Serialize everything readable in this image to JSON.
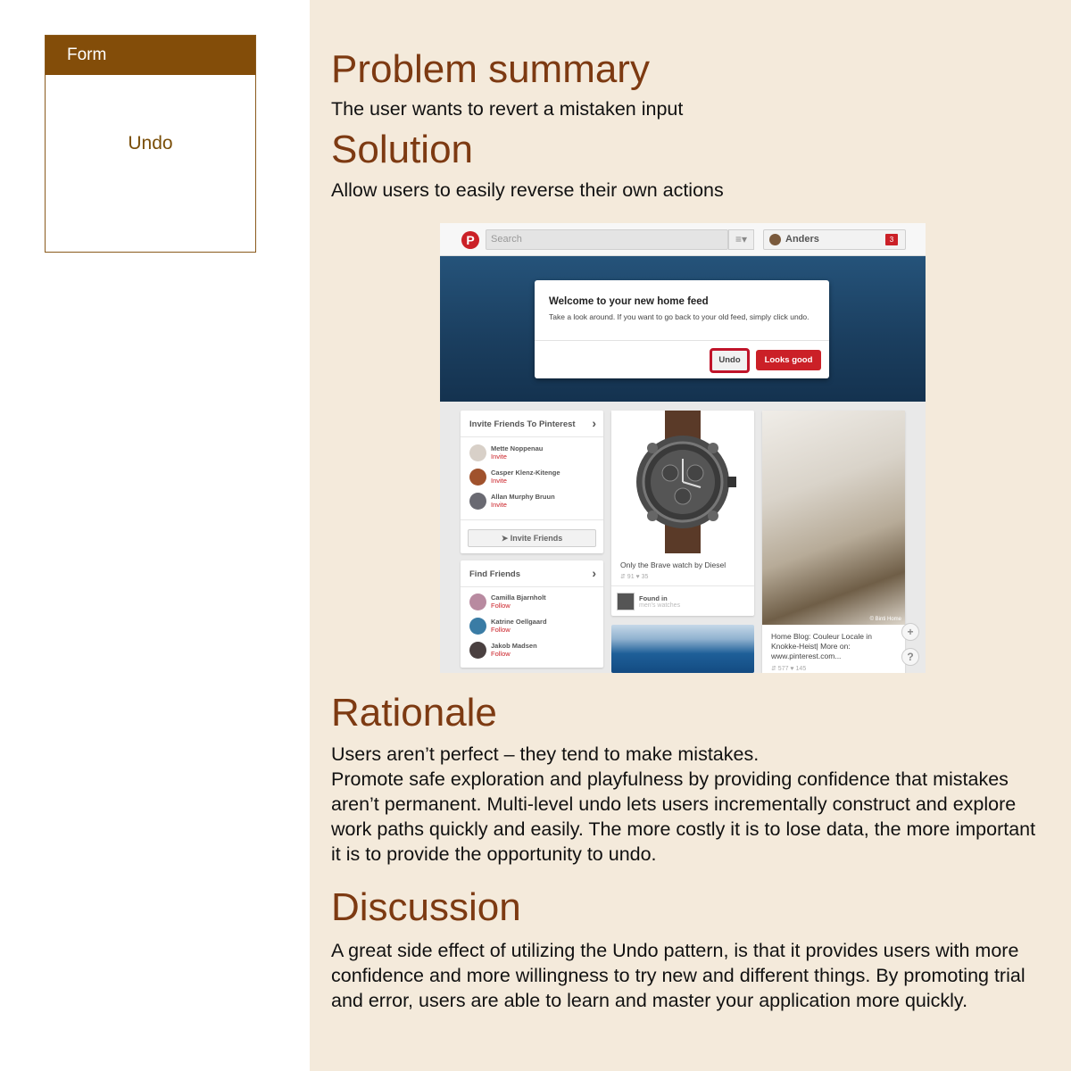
{
  "sidebar": {
    "card_header": "Form",
    "card_item": "Undo"
  },
  "sections": {
    "problem_title": "Problem summary",
    "problem_text": "The user wants to revert a mistaken input",
    "solution_title": "Solution",
    "solution_text": "Allow users to easily reverse their own actions",
    "rationale_title": "Rationale",
    "rationale_line1": "Users aren’t perfect – they tend to make mistakes.",
    "rationale_line2": "Promote safe exploration and playfulness by providing confidence that mistakes aren’t permanent. Multi-level undo lets users incrementally construct and explore work paths quickly and easily. The more costly it is to lose data, the more important it is to provide the opportunity to undo.",
    "discussion_title": "Discussion",
    "discussion_text": "A great side effect of utilizing the Undo pattern, is that it provides users with more confidence and more willingness to try new and different things. By promoting trial and error, users are able to learn and master your application more quickly."
  },
  "screenshot": {
    "logo": "P",
    "search_placeholder": "Search",
    "menu_icon": "≡▾",
    "user_name": "Anders",
    "notification_count": "3",
    "modal_title": "Welcome to your new home feed",
    "modal_text": "Take a look around. If you want to go back to your old feed, simply click undo.",
    "undo_label": "Undo",
    "looks_good_label": "Looks good",
    "invite_title": "Invite Friends To Pinterest",
    "invite_people": [
      {
        "name": "Mette Noppenau",
        "action": "Invite"
      },
      {
        "name": "Casper Klenz-Kitenge",
        "action": "Invite"
      },
      {
        "name": "Allan Murphy Bruun",
        "action": "Invite"
      }
    ],
    "invite_button": "Invite Friends",
    "find_title": "Find Friends",
    "find_people": [
      {
        "name": "Camilla Bjarnholt",
        "action": "Follow"
      },
      {
        "name": "Katrine Oellgaard",
        "action": "Follow"
      },
      {
        "name": "Jakob Madsen",
        "action": "Follow"
      }
    ],
    "watch_caption": "Only the Brave watch by Diesel",
    "watch_stats": "⇵ 91   ♥ 35",
    "found_in": "Found in",
    "found_board": "men's watches",
    "home_caption": "Home Blog: Couleur Locale in Knokke-Heist| More on: www.pinterest.com...",
    "home_stats": "⇵ 577   ♥ 145",
    "photo_credit": "© Binti Home",
    "chevron": "›",
    "plus_label": "+",
    "help_label": "?",
    "colors": {
      "pinterest_red": "#cb2027",
      "hero_blue": "#1b3f60"
    }
  },
  "colors": {
    "sidebar_header": "#834d09",
    "heading": "#7d3a12",
    "content_bg": "#f4eadb"
  }
}
